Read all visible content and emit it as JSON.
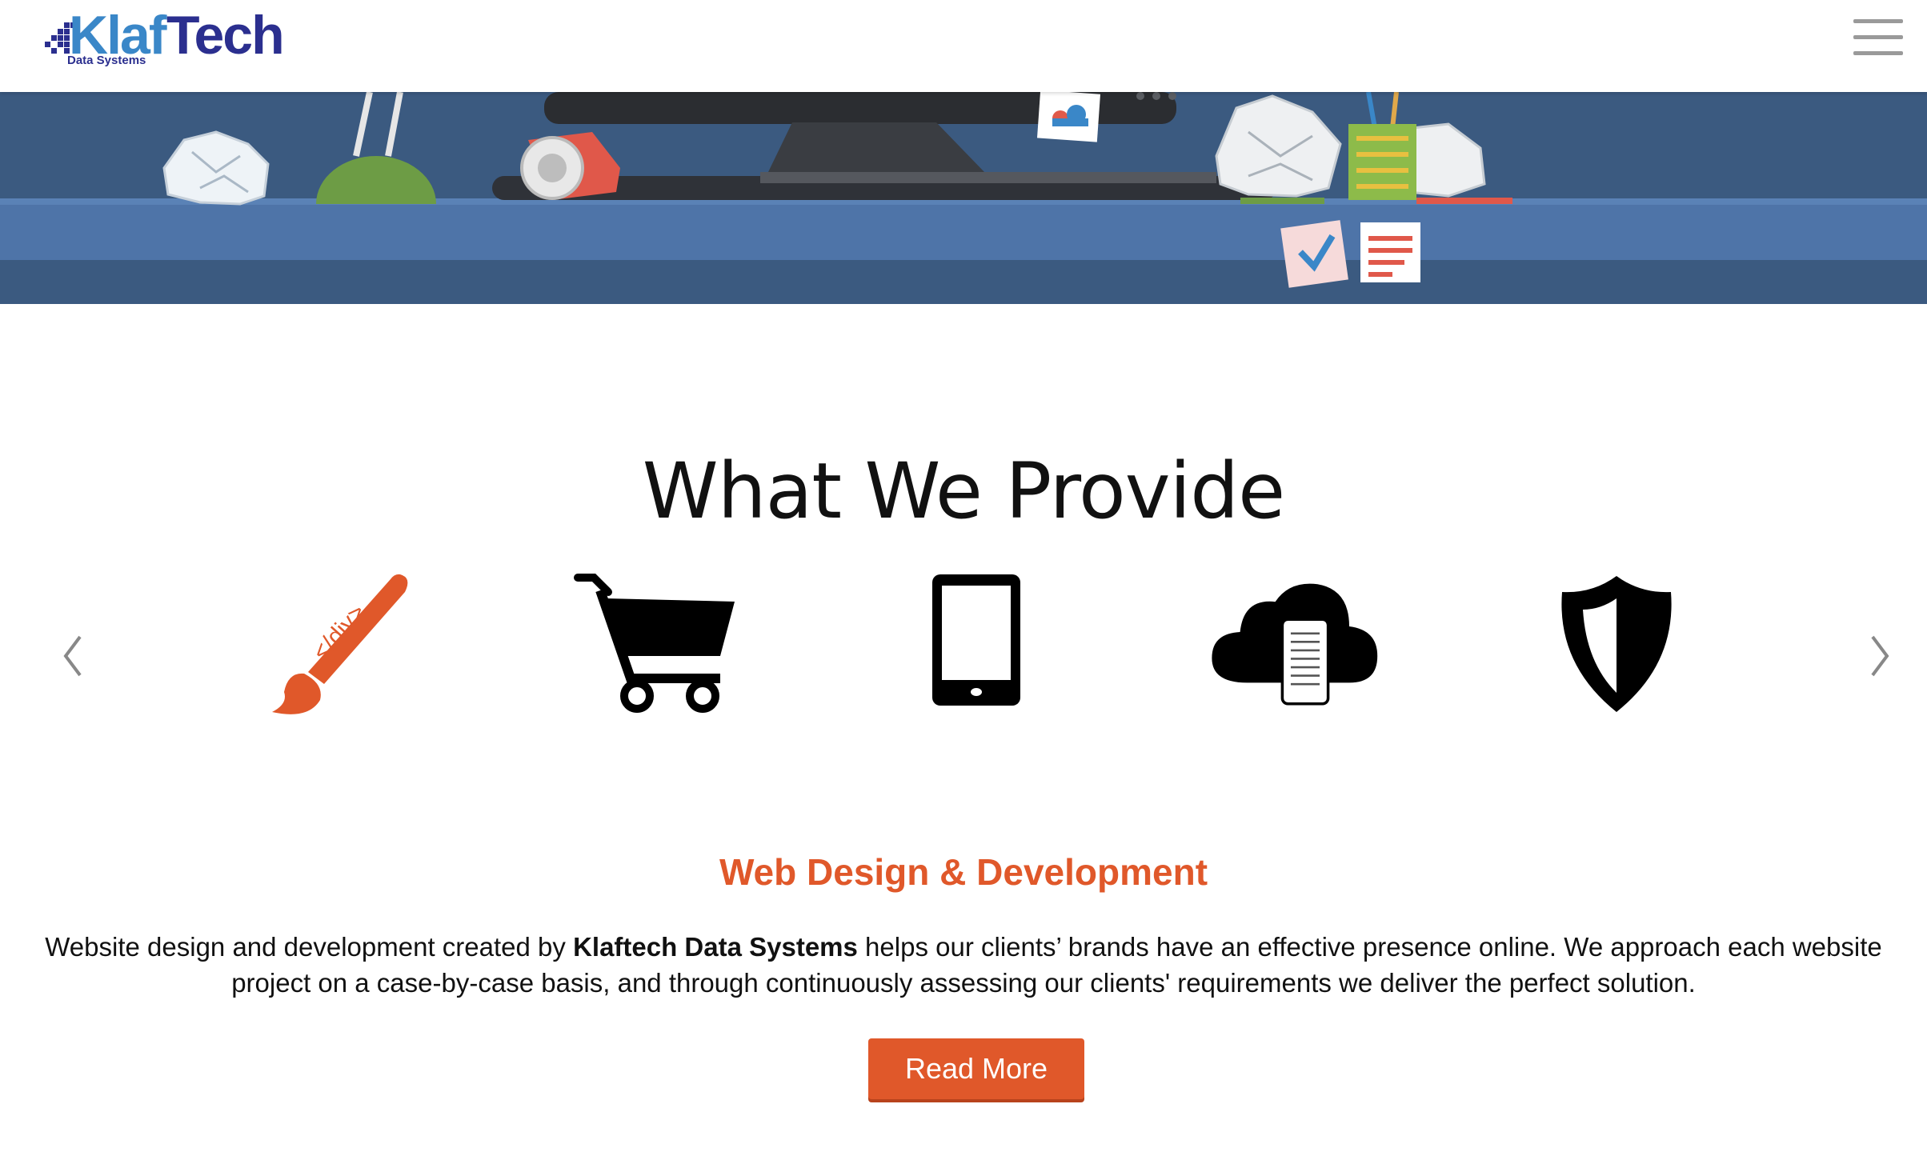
{
  "header": {
    "logo": {
      "word_part1": "Klaf",
      "word_part2": "Tech",
      "subtitle": "Data Systems"
    },
    "menu_icon": "hamburger-menu-icon"
  },
  "banner": {
    "illustration": "desk-with-clutter",
    "colors": {
      "wall": "#3b5a80",
      "desk": "#4e74a8"
    }
  },
  "section": {
    "heading": "What We Provide",
    "services": [
      {
        "icon": "paintbrush-code-icon",
        "badge": "</div>",
        "active": true
      },
      {
        "icon": "shopping-cart-icon",
        "active": false
      },
      {
        "icon": "tablet-icon",
        "active": false
      },
      {
        "icon": "cloud-mobile-icon",
        "active": false
      },
      {
        "icon": "shield-icon",
        "active": false
      }
    ],
    "active_service": {
      "title": "Web Design & Development",
      "desc_before": "Website design and development created by ",
      "desc_brand": "Klaftech Data Systems",
      "desc_after": " helps our clients’ brands have an effective presence online. We approach each website project on a case-by-case basis, and through continuously assessing our clients' requirements we deliver the perfect solution."
    },
    "read_more_label": "Read More"
  },
  "slider": {
    "prev_icon": "chevron-left-icon",
    "next_icon": "chevron-right-icon"
  },
  "colors": {
    "accent": "#e0582a",
    "logo_light": "#3a87c8",
    "logo_dark": "#2b2f8f"
  }
}
